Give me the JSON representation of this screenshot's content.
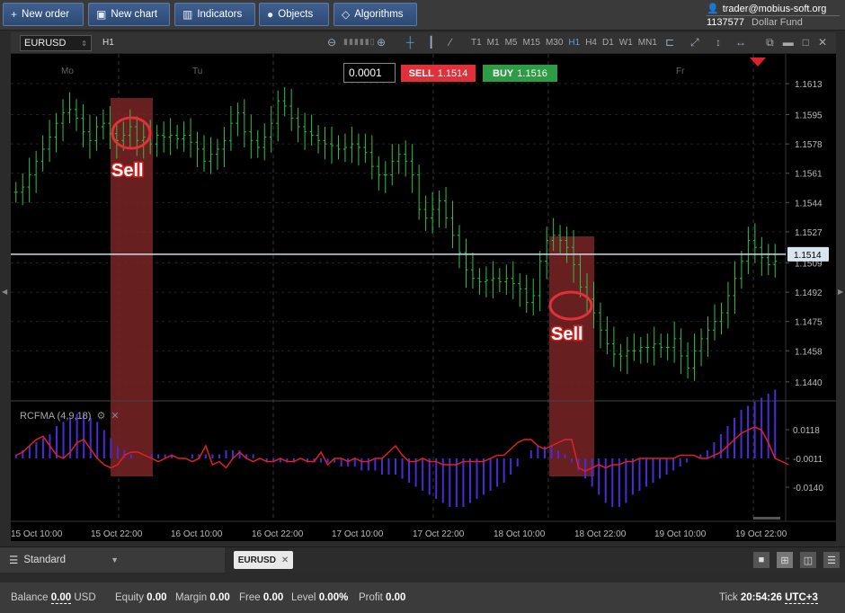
{
  "toolbar": {
    "new_order": "New order",
    "new_chart": "New chart",
    "indicators": "Indicators",
    "objects": "Objects",
    "algorithms": "Algorithms"
  },
  "account": {
    "user": "trader@mobius-soft.org",
    "id": "1137577",
    "fund": "Dollar Fund"
  },
  "chart_header": {
    "symbol": "EURUSD",
    "timeframe": "H1",
    "timeframes": [
      "T1",
      "M1",
      "M5",
      "M15",
      "M30",
      "H1",
      "H4",
      "D1",
      "W1",
      "MN1"
    ],
    "active_timeframe": "H1"
  },
  "trade": {
    "lot": "0.0001",
    "sell_label": "SELL",
    "sell_price": "1.1514",
    "buy_label": "BUY",
    "buy_price": "1.1516"
  },
  "indicator": {
    "name": "RCFMA (4,9,18)"
  },
  "annotations": {
    "sell_1": "Sell",
    "sell_2": "Sell"
  },
  "chart_data": {
    "type": "line",
    "title": "",
    "price_axis": [
      "1.1613",
      "1.1595",
      "1.1578",
      "1.1561",
      "1.1544",
      "1.1527",
      "1.1509",
      "1.1492",
      "1.1475",
      "1.1458",
      "1.1440"
    ],
    "current_price_label": "1.1514",
    "day_labels": [
      "Mo",
      "Tu",
      "Fr"
    ],
    "time_axis": [
      "15 Oct 10:00",
      "15 Oct 22:00",
      "16 Oct 10:00",
      "16 Oct 22:00",
      "17 Oct 10:00",
      "17 Oct 22:00",
      "18 Oct 10:00",
      "18 Oct 22:00",
      "19 Oct 10:00",
      "19 Oct 22:00"
    ],
    "indicator_axis": [
      "0.0118",
      "-0.0011",
      "-0.0140"
    ],
    "price_ylim": [
      1.143,
      1.1625
    ],
    "price_series": [
      1.155,
      1.1553,
      1.156,
      1.1568,
      1.1575,
      1.1582,
      1.159,
      1.1596,
      1.1598,
      1.1593,
      1.1585,
      1.158,
      1.1588,
      1.159,
      1.1584,
      1.158,
      1.1583,
      1.1588,
      1.158,
      1.1582,
      1.1578,
      1.1583,
      1.1582,
      1.1583,
      1.1581,
      1.1583,
      1.1579,
      1.1575,
      1.1568,
      1.1572,
      1.1575,
      1.158,
      1.159,
      1.1596,
      1.1585,
      1.158,
      1.1576,
      1.1582,
      1.159,
      1.1603,
      1.16,
      1.1593,
      1.1588,
      1.1585,
      1.1583,
      1.158,
      1.1578,
      1.1577,
      1.1575,
      1.1576,
      1.1578,
      1.1576,
      1.1573,
      1.1565,
      1.156,
      1.156,
      1.1568,
      1.1572,
      1.1568,
      1.156,
      1.154,
      1.1535,
      1.154,
      1.1545,
      1.1535,
      1.1525,
      1.1515,
      1.1505,
      1.15,
      1.1498,
      1.1499,
      1.15,
      1.1498,
      1.15,
      1.1497,
      1.1494,
      1.1486,
      1.149,
      1.151,
      1.1522,
      1.1525,
      1.1522,
      1.1518,
      1.1508,
      1.1495,
      1.1488,
      1.148,
      1.147,
      1.1462,
      1.1456,
      1.1455,
      1.1458,
      1.1458,
      1.146,
      1.146,
      1.1462,
      1.146,
      1.146,
      1.1465,
      1.1455,
      1.1448,
      1.1458,
      1.1465,
      1.147,
      1.1475,
      1.148,
      1.149,
      1.15,
      1.151,
      1.1522,
      1.1518,
      1.1512,
      1.1508,
      1.151
    ],
    "indicator_bars": [
      1,
      2,
      3,
      4,
      5,
      6,
      8,
      9,
      10,
      11,
      11,
      10,
      9,
      7,
      5,
      3,
      2,
      1,
      0,
      0,
      1,
      1,
      1,
      1,
      0,
      0,
      1,
      1,
      1,
      1,
      1,
      2,
      2,
      2,
      1,
      1,
      0,
      -1,
      -1,
      -1,
      -1,
      -1,
      0,
      -1,
      -1,
      -1,
      -1,
      -1,
      -2,
      -2,
      -2,
      -3,
      -3,
      -3,
      -4,
      -4,
      -4,
      -5,
      -6,
      -7,
      -8,
      -9,
      -10,
      -11,
      -12,
      -12,
      -12,
      -11,
      -10,
      -9,
      -8,
      -7,
      -6,
      -4,
      -2,
      0,
      2,
      3,
      3,
      3,
      2,
      1,
      -1,
      -3,
      -5,
      -7,
      -9,
      -11,
      -12,
      -12,
      -11,
      -9,
      -8,
      -7,
      -6,
      -5,
      -4,
      -3,
      -2,
      -1,
      0,
      1,
      2,
      4,
      6,
      8,
      10,
      12,
      13,
      14,
      15,
      16,
      17
    ],
    "indicator_line": [
      1,
      2,
      4,
      6,
      7,
      4,
      1,
      0,
      2,
      5,
      6,
      3,
      0,
      -2,
      -3,
      -2,
      1,
      2,
      2,
      1,
      0,
      -1,
      0,
      1,
      0,
      0,
      -1,
      0,
      4,
      -2,
      -1,
      -3,
      0,
      2,
      0,
      -1,
      0,
      -1,
      -1,
      0,
      -1,
      -1,
      0,
      -1,
      -1,
      2,
      -2,
      0,
      0,
      -1,
      0,
      -1,
      -1,
      0,
      0,
      2,
      4,
      1,
      -1,
      -1,
      0,
      -1,
      -1,
      -2,
      -2,
      -2,
      -1,
      -1,
      -1,
      -1,
      0,
      1,
      1,
      3,
      5,
      6,
      6,
      4,
      3,
      4,
      5,
      6,
      6,
      -3,
      -4,
      -3,
      -2,
      -3,
      -2,
      -2,
      -1,
      -1,
      0,
      0,
      0,
      0,
      0,
      0,
      1,
      1,
      1,
      0,
      0,
      1,
      2,
      4,
      6,
      8,
      9,
      10,
      9,
      5,
      0,
      -1,
      -2
    ]
  },
  "layout_bar": {
    "workspace": "Standard",
    "tab": "EURUSD"
  },
  "status": {
    "balance_label": "Balance",
    "balance": "0.00",
    "currency": "USD",
    "equity_label": "Equity",
    "equity": "0.00",
    "margin_label": "Margin",
    "margin": "0.00",
    "free_label": "Free",
    "free": "0.00",
    "level_label": "Level",
    "level": "0.00%",
    "profit_label": "Profit",
    "profit": "0.00",
    "tick_label": "Tick",
    "tick_time": "20:54:26",
    "tz": "UTC+3"
  }
}
